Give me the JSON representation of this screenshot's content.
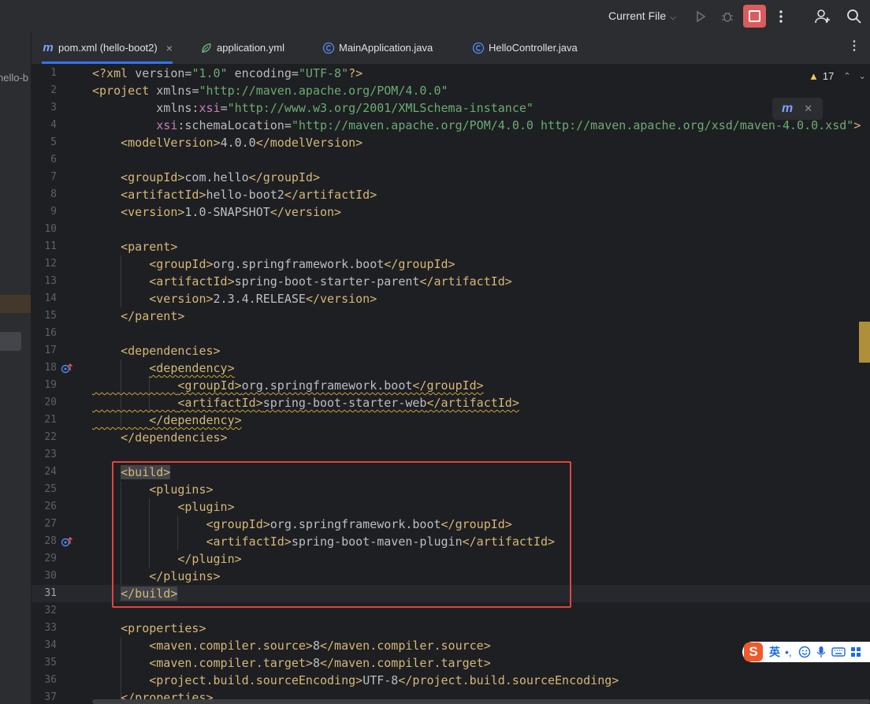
{
  "toolbar": {
    "run_config": "Current File",
    "icons": [
      "run-icon",
      "debug-icon",
      "stop-icon",
      "more-vertical-icon",
      "add-user-icon",
      "search-icon"
    ],
    "stop_color": "#db5c5c"
  },
  "project_panel": {
    "visible_text": "hello-b"
  },
  "tabs": [
    {
      "label": "pom.xml (hello-boot2)",
      "icon": "maven-icon",
      "active": true,
      "close": "×"
    },
    {
      "label": "application.yml",
      "icon": "spring-config-icon"
    },
    {
      "label": "MainApplication.java",
      "icon": "java-class-icon"
    },
    {
      "label": "HelloController.java",
      "icon": "java-class-icon"
    }
  ],
  "editor": {
    "warnings_count": "17",
    "current_line": "31",
    "highlight_color": "#e0443e",
    "lines": [
      "1",
      "2",
      "3",
      "4",
      "5",
      "6",
      "7",
      "8",
      "9",
      "10",
      "11",
      "12",
      "13",
      "14",
      "15",
      "16",
      "17",
      "18",
      "19",
      "20",
      "21",
      "22",
      "23",
      "24",
      "25",
      "26",
      "27",
      "28",
      "29",
      "30",
      "31",
      "32",
      "33",
      "34",
      "35",
      "36",
      "37"
    ],
    "code": {
      "l1": {
        "p1": "<?xml ",
        "p2": "version",
        "p3": "=",
        "p4": "\"1.0\"",
        "p5": " ",
        "p6": "encoding",
        "p7": "=",
        "p8": "\"UTF-8\"",
        "p9": "?>"
      },
      "l2": {
        "p1": "<project ",
        "p2": "xmlns",
        "p3": "=",
        "p4": "\"http://maven.apache.org/POM/4.0.0\""
      },
      "l3": {
        "p1": "xmlns:",
        "p2": "xsi",
        "p3": "=",
        "p4": "\"http://www.w3.org/2001/XMLSchema-instance\""
      },
      "l4": {
        "p1": "xsi",
        "p2": ":schemaLocation",
        "p3": "=",
        "p4": "\"http://maven.apache.org/POM/4.0.0 http://maven.apache.org/xsd/maven-4.0.0.xsd\"",
        "p5": ">"
      },
      "l5": {
        "o": "<modelVersion>",
        "v": "4.0.0",
        "c": "</modelVersion>"
      },
      "l7": {
        "o": "<groupId>",
        "v": "com.hello",
        "c": "</groupId>"
      },
      "l8": {
        "o": "<artifactId>",
        "v": "hello-boot2",
        "c": "</artifactId>"
      },
      "l9": {
        "o": "<version>",
        "v": "1.0-SNAPSHOT",
        "c": "</version>"
      },
      "l11": "<parent>",
      "l12": {
        "o": "<groupId>",
        "v": "org.springframework.boot",
        "c": "</groupId>"
      },
      "l13": {
        "o": "<artifactId>",
        "v": "spring-boot-starter-parent",
        "c": "</artifactId>"
      },
      "l14": {
        "o": "<version>",
        "v": "2.3.4.RELEASE",
        "c": "</version>"
      },
      "l15": "</parent>",
      "l17": "<dependencies>",
      "l18": "<dependency>",
      "l19": {
        "o": "<groupId>",
        "v": "org.springframework.boot",
        "c": "</groupId>"
      },
      "l20": {
        "o": "<artifactId>",
        "v": "spring-boot-starter-web",
        "c": "</artifactId>"
      },
      "l21": "</dependency>",
      "l22": "</dependencies>",
      "l24": "<build>",
      "l25": "<plugins>",
      "l26": "<plugin>",
      "l27": {
        "o": "<groupId>",
        "v": "org.springframework.boot",
        "c": "</groupId>"
      },
      "l28": {
        "o": "<artifactId>",
        "v": "spring-boot-maven-plugin",
        "c": "</artifactId>"
      },
      "l29": "</plugin>",
      "l30": "</plugins>",
      "l31": "</build>",
      "l33": "<properties>",
      "l34": {
        "o": "<maven.compiler.source>",
        "v": "8",
        "c": "</maven.compiler.source>"
      },
      "l35": {
        "o": "<maven.compiler.target>",
        "v": "8",
        "c": "</maven.compiler.target>"
      },
      "l36": {
        "o": "<project.build.sourceEncoding>",
        "v": "UTF-8",
        "c": "</project.build.sourceEncoding>"
      },
      "l37": "</properties>"
    }
  },
  "ime": {
    "logo": "S",
    "lang": "英",
    "punct": "•,"
  }
}
